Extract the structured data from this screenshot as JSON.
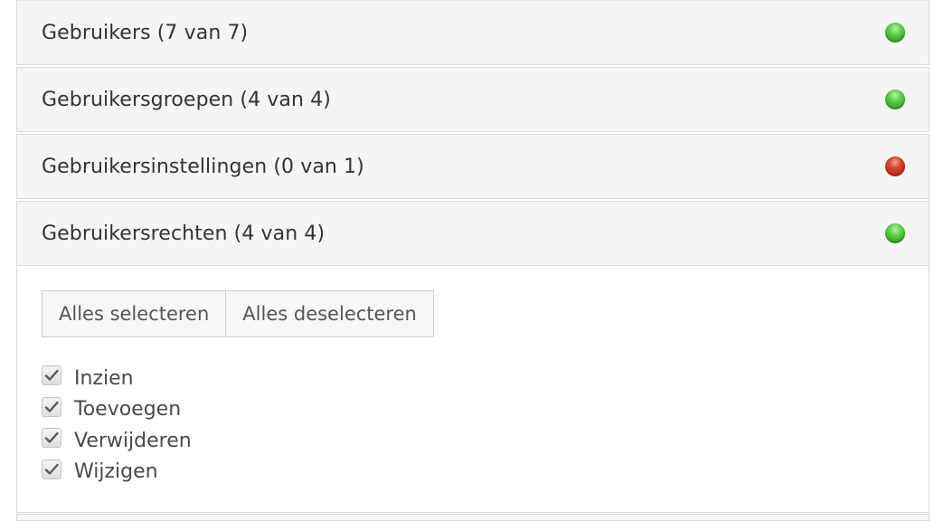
{
  "panels": [
    {
      "title": "Gebruikers (7 van 7)",
      "status": "green"
    },
    {
      "title": "Gebruikersgroepen (4 van 4)",
      "status": "green"
    },
    {
      "title": "Gebruikersinstellingen (0 van 1)",
      "status": "red"
    },
    {
      "title": "Gebruikersrechten (4 van 4)",
      "status": "green"
    }
  ],
  "actions": {
    "select_all": "Alles selecteren",
    "deselect_all": "Alles deselecteren"
  },
  "permissions": [
    {
      "label": "Inzien",
      "checked": true
    },
    {
      "label": "Toevoegen",
      "checked": true
    },
    {
      "label": "Verwijderen",
      "checked": true
    },
    {
      "label": "Wijzigen",
      "checked": true
    }
  ],
  "colors": {
    "status_green": "#38b526",
    "status_red": "#c23620"
  }
}
